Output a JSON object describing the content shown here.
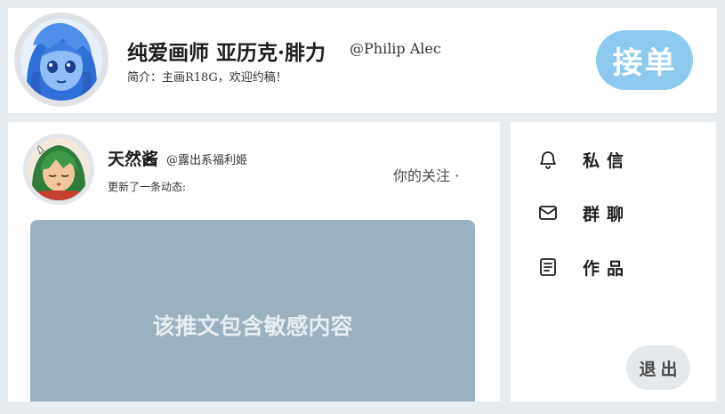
{
  "profile": {
    "name": "纯爱画师 亚历克·腓力",
    "handle": "@Philip Alec",
    "bio": "简介：主画R18G，欢迎约稿！",
    "accept_button": "接单",
    "avatar": "anime-girl-blue-avatar",
    "accent_color": "#8ccbef"
  },
  "post": {
    "author": "天然酱",
    "handle": "@露出系福利姬",
    "action": "更新了一条动态:",
    "follow_tag": "你的关注 ·",
    "sensitive_notice": "该推文包含敏感内容",
    "avatar": "green-hair-character-avatar",
    "overlay_color": "#9bb1bf"
  },
  "menu": {
    "items": [
      {
        "label": "私信",
        "icon": "bell-icon"
      },
      {
        "label": "群聊",
        "icon": "mail-icon"
      },
      {
        "label": "作品",
        "icon": "document-icon"
      }
    ],
    "logout": "退出"
  }
}
